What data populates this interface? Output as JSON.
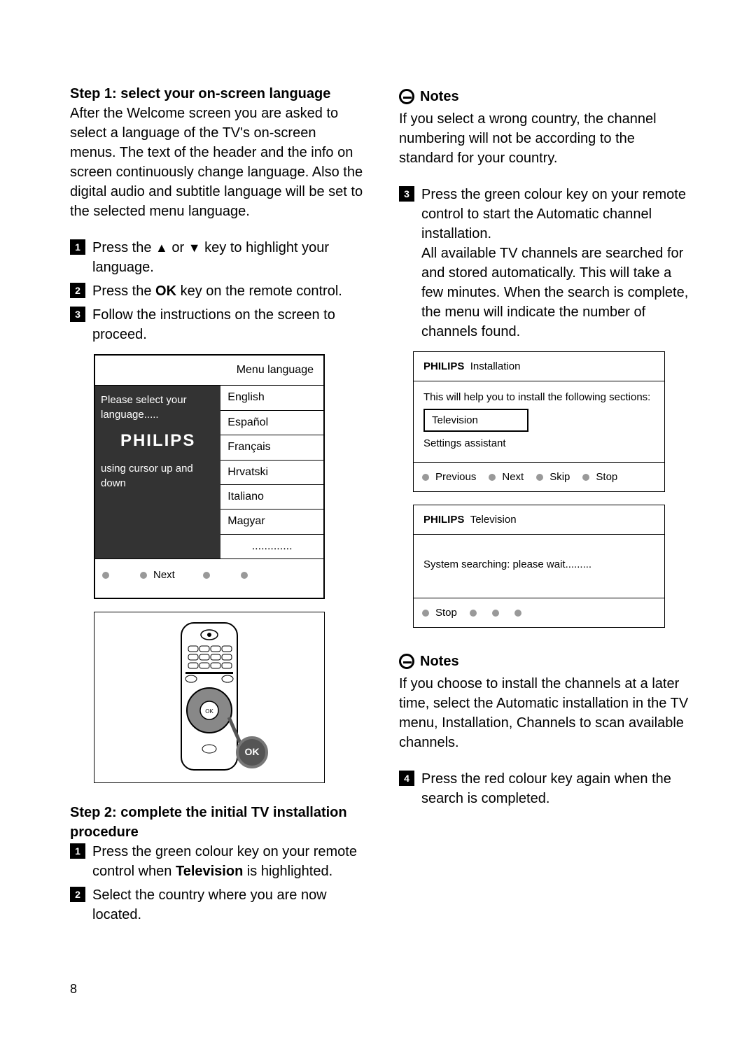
{
  "leftCol": {
    "step1Heading": "Step 1: select your on-screen language",
    "step1Para": "After the Welcome screen you are asked to select a language of the TV's on-screen menus. The text of the header and the info on screen continuously change language. Also the digital audio and subtitle language will be set to the selected menu language.",
    "items": [
      {
        "pre": "Press the ",
        "arrowUp": "▲",
        "mid": " or ",
        "arrowDn": "▼",
        "post": " key to highlight your language."
      },
      {
        "pre": "Press the ",
        "bold": "OK",
        "post": " key on the remote control."
      },
      {
        "full": "Follow the instructions on the screen to proceed."
      }
    ],
    "menuBox": {
      "header": "Menu language",
      "leftTop": "Please select your language.....",
      "logo": "PHILIPS",
      "leftBottom": "using cursor up and down",
      "langs": [
        "English",
        "Español",
        "Français",
        "Hrvatski",
        "Italiano",
        "Magyar",
        "............."
      ],
      "footerNext": "Next"
    },
    "okLabel": "OK",
    "step2Heading": "Step 2: complete the initial TV installation procedure",
    "step2Items": [
      {
        "pre": "Press the green colour key on your remote control when ",
        "bold": "Television",
        "post": " is highlighted."
      },
      {
        "full": "Select the country where you are now located."
      }
    ]
  },
  "rightCol": {
    "notesLabel": "Notes",
    "notes1": "If you select a wrong country, the channel numbering will not be according to the standard for your country.",
    "item3": "Press the green colour key on your remote control to start the Automatic channel installation.\nAll available TV channels are searched for and stored automatically.  This will take a few minutes.  When the search is complete, the menu will indicate the number of channels found.",
    "tvBox1": {
      "brand": "PHILIPS",
      "title": "Installation",
      "body1": "This will help you to install the following sections:",
      "sec1": "Television",
      "sec2": "Settings assistant",
      "footer": [
        "Previous",
        "Next",
        "Skip",
        "Stop"
      ]
    },
    "tvBox2": {
      "brand": "PHILIPS",
      "title": "Television",
      "body": "System searching: please wait.........",
      "footer": [
        "Stop"
      ]
    },
    "notes2": "If you choose to install the channels at a later time, select the Automatic installation in the TV menu, Installation, Channels to scan available channels.",
    "item4": "Press the red colour key again when the search is completed."
  },
  "pageNum": "8"
}
